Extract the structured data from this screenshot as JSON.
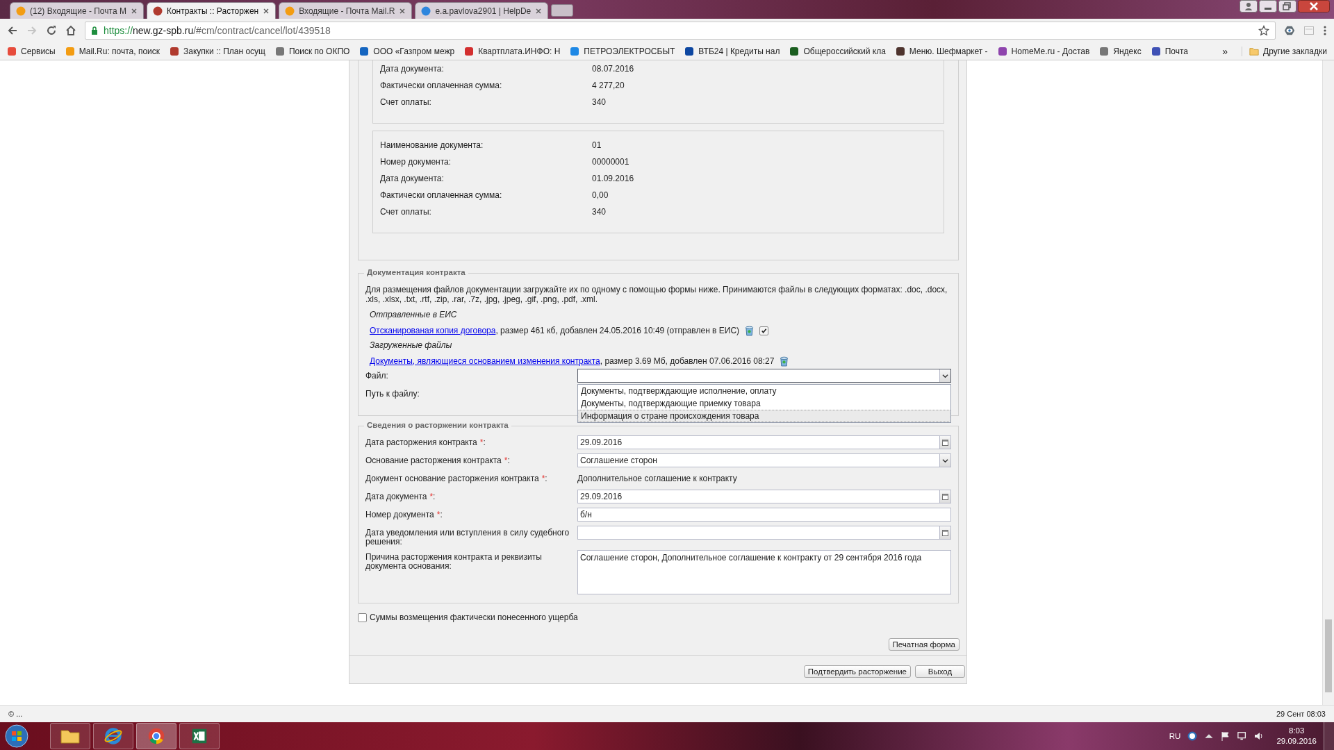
{
  "browser": {
    "tabs": [
      {
        "title": "(12) Входящие - Почта M",
        "color": "#f39c12",
        "selected": false
      },
      {
        "title": "Контракты :: Расторжен",
        "color": "#b03a2e",
        "selected": true
      },
      {
        "title": "Входящие - Почта Mail.R",
        "color": "#f39c12",
        "selected": false
      },
      {
        "title": "e.a.pavlova2901 | HelpDe",
        "color": "#2e86de",
        "selected": false
      }
    ],
    "url_scheme": "https://",
    "url_host": "new.gz-spb.ru",
    "url_path": "/#cm/contract/cancel/lot/439518",
    "bookmarks": [
      {
        "title": "Сервисы",
        "color": "#e74c3c"
      },
      {
        "title": "Mail.Ru: почта, поиск",
        "color": "#f39c12"
      },
      {
        "title": "Закупки :: План осущ",
        "color": "#b03a2e"
      },
      {
        "title": "Поиск по ОКПО",
        "color": "#777777"
      },
      {
        "title": "ООО «Газпром межр",
        "color": "#1565c0"
      },
      {
        "title": "Квартплата.ИНФО: Н",
        "color": "#d32f2f"
      },
      {
        "title": "ПЕТРОЭЛЕКТРОСБЫТ",
        "color": "#1e88e5"
      },
      {
        "title": "ВТБ24 | Кредиты нал",
        "color": "#0d47a1"
      },
      {
        "title": "Общероссийский кла",
        "color": "#1b5e20"
      },
      {
        "title": "Меню. Шефмаркет -",
        "color": "#4e342e"
      },
      {
        "title": "HomeMe.ru - Достав",
        "color": "#8e44ad"
      },
      {
        "title": "Яндекс",
        "color": "#777777"
      },
      {
        "title": "Почта",
        "color": "#3f51b5"
      }
    ],
    "bookmarks_overflow": "»",
    "other_bookmarks": "Другие закладки"
  },
  "payment_groups": [
    {
      "rows": [
        {
          "label": "Дата документа:",
          "value": "08.07.2016"
        },
        {
          "label": "Фактически оплаченная сумма:",
          "value": "4 277,20"
        },
        {
          "label": "Счет оплаты:",
          "value": "340"
        }
      ]
    },
    {
      "rows": [
        {
          "label": "Наименование документа:",
          "value": "01"
        },
        {
          "label": "Номер документа:",
          "value": "00000001"
        },
        {
          "label": "Дата документа:",
          "value": "01.09.2016"
        },
        {
          "label": "Фактически оплаченная сумма:",
          "value": "0,00"
        },
        {
          "label": "Счет оплаты:",
          "value": "340"
        }
      ]
    }
  ],
  "documentation": {
    "legend": "Документация контракта",
    "hint": "Для размещения файлов документации загружайте их по одному с помощью формы ниже. Принимаются файлы в следующих форматах: .doc, .docx, .xls, .xlsx, .txt, .rtf, .zip, .rar, .7z, .jpg, .jpeg, .gif, .png, .pdf, .xml.",
    "sent_heading": "Отправленные в ЕИС",
    "sent_files": [
      {
        "link": "Отсканированая копия договора",
        "info": ", размер 461 кб, добавлен 24.05.2016 10:49 (отправлен в ЕИС)",
        "checked": true
      }
    ],
    "uploaded_heading": "Загруженные файлы",
    "uploaded_files": [
      {
        "link": "Документы, являющиеся основанием изменения контракта",
        "info": ", размер 3.69 Мб, добавлен 07.06.2016 08:27"
      }
    ],
    "file_label": "Файл:",
    "path_label": "Путь к файлу:",
    "file_expanded": true,
    "file_options": [
      {
        "label": "Документы, подтверждающие исполнение, оплату",
        "selected": false
      },
      {
        "label": "Документы, подтверждающие приемку товара",
        "selected": false
      },
      {
        "label": "Информация о стране происхождения товара",
        "selected": true
      }
    ]
  },
  "termination": {
    "legend": "Сведения о расторжении контракта",
    "fields": [
      {
        "kind": "date",
        "label": "Дата расторжения контракта",
        "mark": "*",
        "colon": ":",
        "value": "29.09.2016"
      },
      {
        "kind": "select",
        "label": "Основание расторжения контракта",
        "mark": "*",
        "colon": ":",
        "value": "Соглашение сторон"
      },
      {
        "kind": "static",
        "label": "Документ основание расторжения контракта",
        "mark": "*",
        "colon": ":",
        "value": "Дополнительное соглашение к контракту"
      },
      {
        "kind": "date",
        "label": "Дата документа",
        "mark": "*",
        "colon": ":",
        "value": "29.09.2016"
      },
      {
        "kind": "text",
        "label": "Номер документа",
        "mark": "*",
        "colon": ":",
        "value": "б/н"
      },
      {
        "kind": "date",
        "label": "Дата уведомления или вступления в силу судебного решения:"
      },
      {
        "kind": "textarea",
        "label": "Причина расторжения контракта и реквизиты документа основания:",
        "value": "Соглашение сторон, Дополнительное соглашение к контракту от 29 сентября 2016 года"
      }
    ]
  },
  "damages": {
    "label": "Суммы возмещения фактически понесенного ущерба",
    "checked": false
  },
  "print_button": "Печатная форма",
  "buttons": [
    "Подтвердить расторжение",
    "Выход"
  ],
  "status_bar": {
    "left": "© ...",
    "right": "29 Сент 08:03"
  },
  "taskbar": {
    "language": "RU",
    "time": "8:03",
    "date": "29.09.2016"
  }
}
